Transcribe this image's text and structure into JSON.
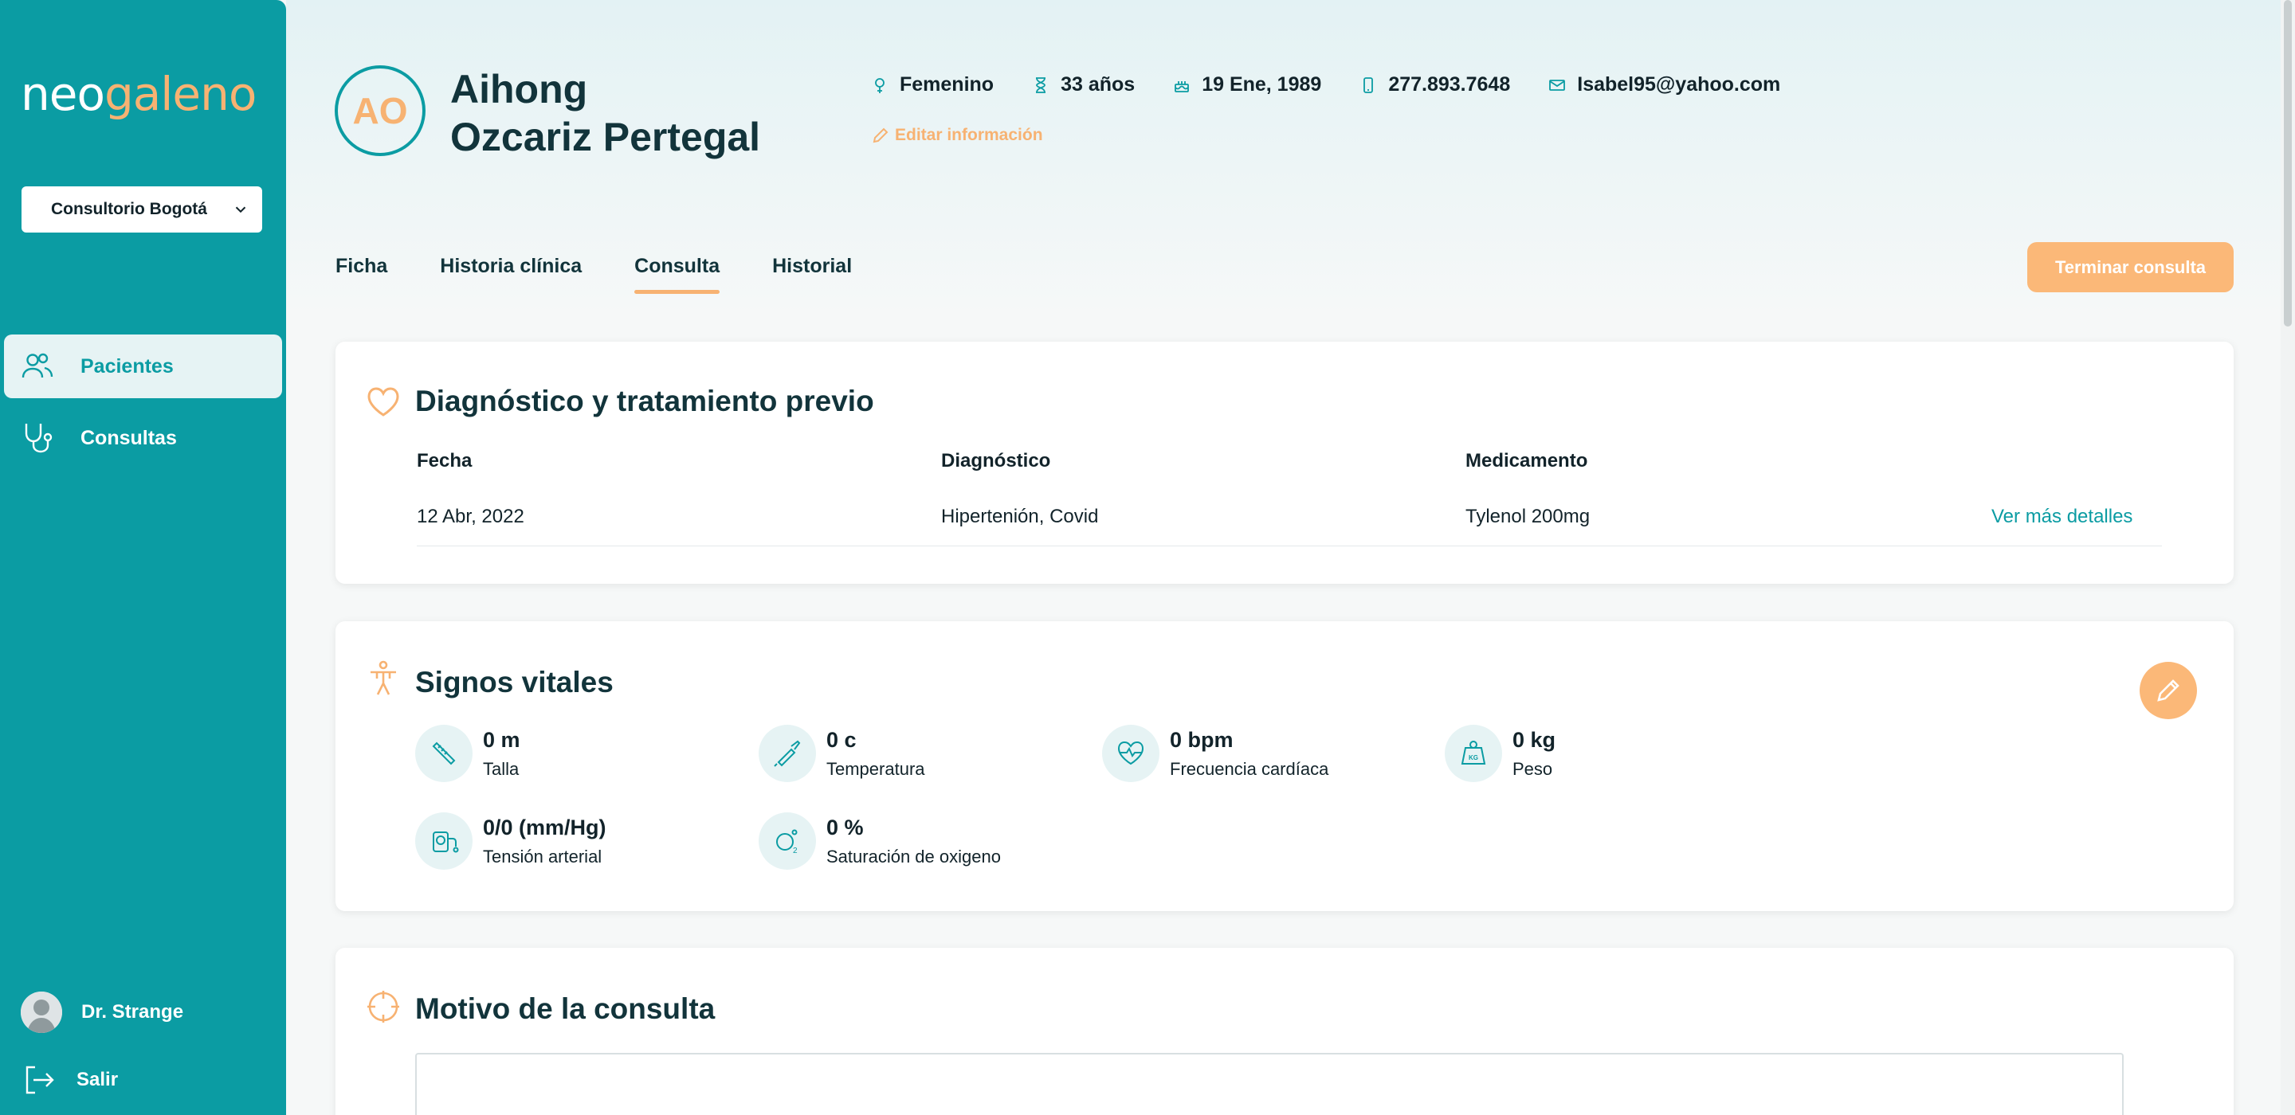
{
  "brand": {
    "part1": "neo",
    "part2": "galeno"
  },
  "sidebar": {
    "clinic_select": "Consultorio Bogotá",
    "items": [
      {
        "label": "Pacientes",
        "icon": "users-icon",
        "active": true
      },
      {
        "label": "Consultas",
        "icon": "stethoscope-icon",
        "active": false
      }
    ],
    "user": {
      "name": "Dr. Strange"
    },
    "logout": "Salir"
  },
  "patient": {
    "initials": "AO",
    "first_name": "Aihong",
    "last_name": "Ozcariz Pertegal",
    "gender": "Femenino",
    "age": "33 años",
    "birthdate": "19 Ene, 1989",
    "phone": "277.893.7648",
    "email": "Isabel95@yahoo.com",
    "edit_label": "Editar información"
  },
  "tabs": [
    {
      "label": "Ficha"
    },
    {
      "label": "Historia clínica"
    },
    {
      "label": "Consulta",
      "active": true
    },
    {
      "label": "Historial"
    }
  ],
  "finish_button": "Terminar consulta",
  "diagnosis": {
    "title": "Diagnóstico y tratamiento previo",
    "headers": [
      "Fecha",
      "Diagnóstico",
      "Medicamento"
    ],
    "rows": [
      {
        "date": "12 Abr, 2022",
        "diagnosis": "Hipertenión, Covid",
        "medication": "Tylenol 200mg",
        "link": "Ver más detalles"
      }
    ]
  },
  "vitals": {
    "title": "Signos vitales",
    "items": [
      {
        "value": "0 m",
        "label": "Talla",
        "icon": "ruler-icon"
      },
      {
        "value": "0 c",
        "label": "Temperatura",
        "icon": "thermometer-icon"
      },
      {
        "value": "0 bpm",
        "label": "Frecuencia cardíaca",
        "icon": "heart-rate-icon"
      },
      {
        "value": "0 kg",
        "label": "Peso",
        "icon": "weight-icon"
      },
      {
        "value": "0/0 (mm/Hg)",
        "label": "Tensión arterial",
        "icon": "blood-pressure-icon"
      },
      {
        "value": "0 %",
        "label": "Saturación de oxigeno",
        "icon": "oxygen-icon"
      }
    ]
  },
  "reason": {
    "title": "Motivo de la consulta"
  },
  "colors": {
    "primary": "#0b9ca3",
    "accent": "#f7b272",
    "text": "#12343b"
  }
}
